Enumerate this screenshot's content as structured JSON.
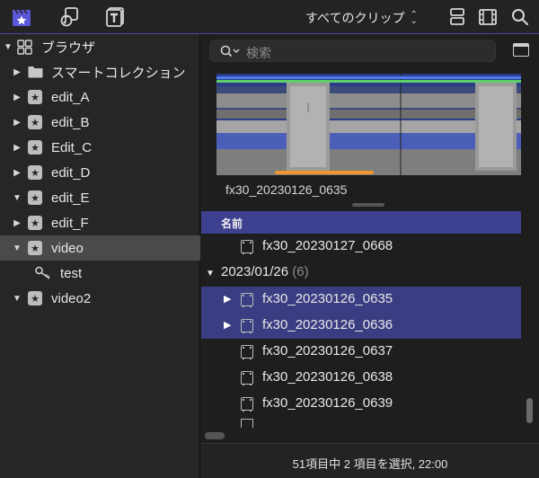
{
  "toolbar": {
    "library_icon": "clapper-star-icon",
    "photos_audio_icon": "music-photo-icon",
    "titles_icon": "titles-t-icon",
    "clips_filter": "すべてのクリップ",
    "filmstrip_view_icon": "filmstrip-view-icon",
    "list_view_icon": "list-view-icon",
    "search_icon": "search-icon",
    "accent_color": "#4a46a8"
  },
  "sidebar": {
    "root": {
      "label": "ブラウザ"
    },
    "items": [
      {
        "label": "スマートコレクション",
        "icon": "folder-icon",
        "disclosure": "collapsed"
      },
      {
        "label": "edit_A",
        "icon": "star-event-icon",
        "disclosure": "collapsed"
      },
      {
        "label": "edit_B",
        "icon": "star-event-icon",
        "disclosure": "collapsed"
      },
      {
        "label": "Edit_C",
        "icon": "star-event-icon",
        "disclosure": "collapsed"
      },
      {
        "label": "edit_D",
        "icon": "star-event-icon",
        "disclosure": "collapsed"
      },
      {
        "label": "edit_E",
        "icon": "star-event-icon",
        "disclosure": "expanded"
      },
      {
        "label": "edit_F",
        "icon": "star-event-icon",
        "disclosure": "collapsed"
      },
      {
        "label": "video",
        "icon": "star-event-icon",
        "disclosure": "expanded",
        "selected": true
      },
      {
        "label": "test",
        "icon": "key-icon",
        "disclosure": "none"
      },
      {
        "label": "video2",
        "icon": "star-event-icon",
        "disclosure": "expanded"
      }
    ]
  },
  "browser": {
    "search_placeholder": "検索",
    "clip_caption": "fx30_20230126_0635",
    "list_header": "名前",
    "rows_before": [
      {
        "name": "fx30_20230127_0668"
      }
    ],
    "group": {
      "date": "2023/01/26",
      "count": "(6)"
    },
    "rows": [
      {
        "name": "fx30_20230126_0635",
        "selected": true
      },
      {
        "name": "fx30_20230126_0636",
        "selected": true
      },
      {
        "name": "fx30_20230126_0637",
        "selected": false
      },
      {
        "name": "fx30_20230126_0638",
        "selected": false
      },
      {
        "name": "fx30_20230126_0639",
        "selected": false
      }
    ],
    "status": "51項目中 2 項目を選択, 22:00"
  }
}
